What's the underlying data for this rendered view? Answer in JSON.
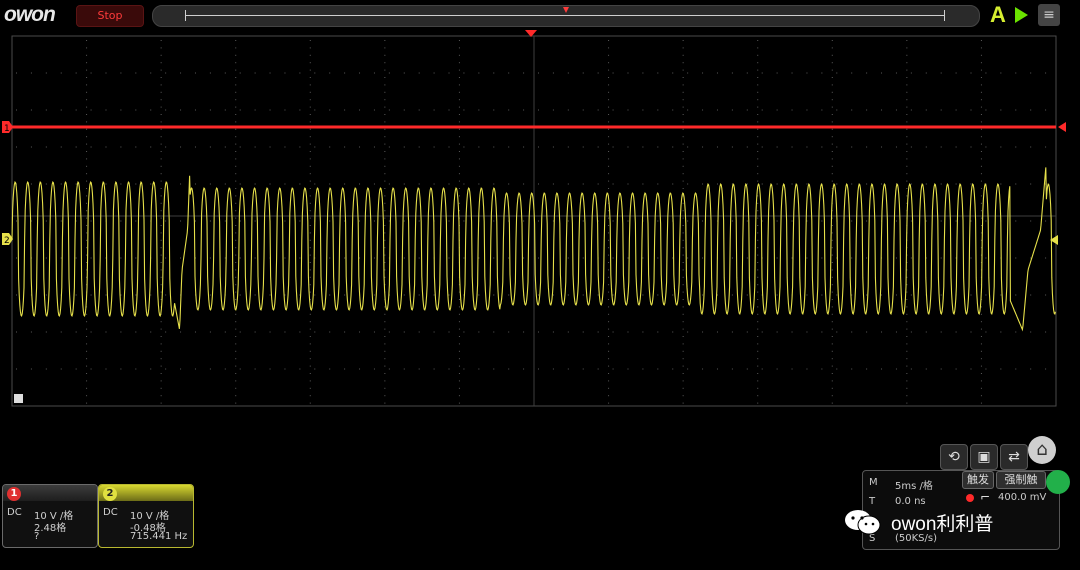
{
  "brand": {
    "logo_text": "owon"
  },
  "status": {
    "acq_state": "Stop"
  },
  "trigger_mode_letter": "A",
  "colors": {
    "ch1": "#ff2a2a",
    "ch2": "#e6e04a",
    "grid": "#3a3a3a",
    "bg": "#000000"
  },
  "channels": [
    {
      "id": "1",
      "coupling": "DC",
      "scale": "10 V /格",
      "offset": "2.48格",
      "freq": "?"
    },
    {
      "id": "2",
      "coupling": "DC",
      "scale": "10 V /格",
      "offset": "-0.48格",
      "freq": "715.441 Hz"
    }
  ],
  "markers": {
    "ch1_label": "1",
    "ch2_label": "2"
  },
  "timebase": {
    "m_label": "M",
    "m_value": "5ms /格",
    "t_label": "T",
    "t_value": "0.0 ns",
    "s_label": "S",
    "s_value": "(50KS/s)"
  },
  "trigger": {
    "tab1": "触发",
    "tab2": "强制触",
    "level": "400.0 mV"
  },
  "watermark": {
    "text": "owon利利普"
  },
  "icons": [
    "refresh-icon",
    "save-icon",
    "device-icon",
    "home-icon",
    "menu-icon",
    "run-icon"
  ]
}
